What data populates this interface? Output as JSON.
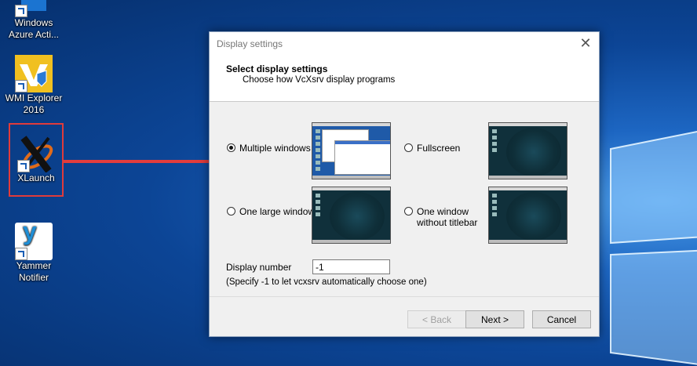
{
  "desktop": {
    "icons": [
      {
        "label_line1": "Windows",
        "label_line2": "Azure Acti..."
      },
      {
        "label_line1": "WMI Explorer",
        "label_line2": "2016"
      },
      {
        "label_line1": "XLaunch",
        "label_line2": ""
      },
      {
        "label_line1": "Yammer",
        "label_line2": "Notifier"
      }
    ]
  },
  "dialog": {
    "title": "Display settings",
    "close_glyph": "✕",
    "header_title": "Select display settings",
    "header_subtitle": "Choose how VcXsrv display programs",
    "options": [
      {
        "label": "Multiple windows",
        "checked": true
      },
      {
        "label": "Fullscreen",
        "checked": false
      },
      {
        "label": "One large window",
        "checked": false
      },
      {
        "label_line1": "One window",
        "label_line2": "without titlebar",
        "checked": false
      }
    ],
    "display_number_label": "Display number",
    "display_number_value": "-1",
    "hint": "(Specify -1 to let vcxsrv automatically choose one)",
    "buttons": {
      "back": "< Back",
      "next": "Next >",
      "cancel": "Cancel"
    }
  },
  "colors": {
    "highlight": "#e03b3b",
    "accent": "#0a3f86"
  }
}
